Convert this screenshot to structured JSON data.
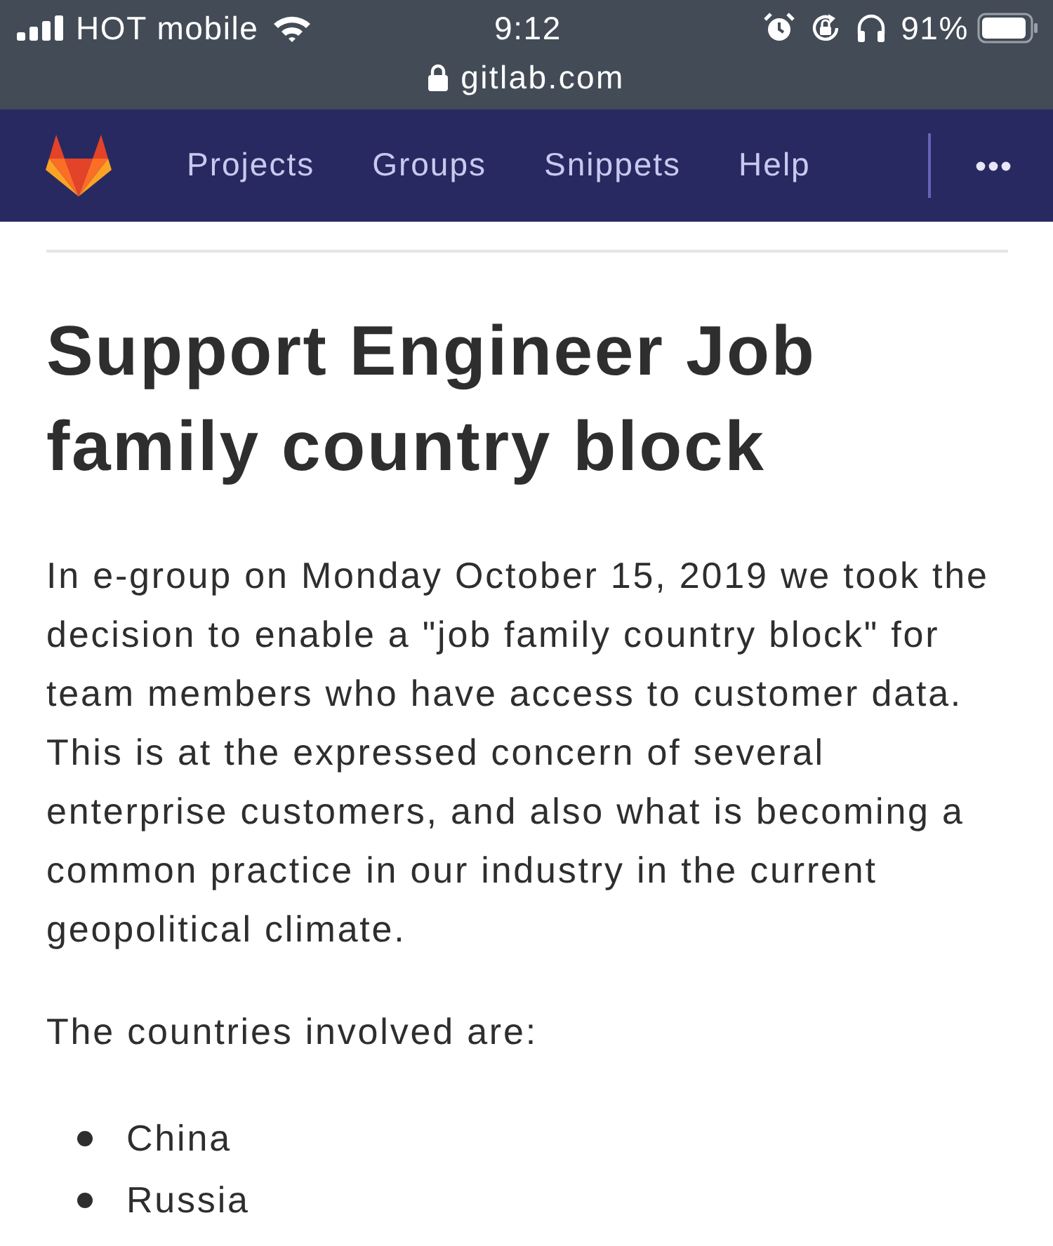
{
  "status_bar": {
    "carrier": "HOT mobile",
    "time": "9:12",
    "battery": "91%"
  },
  "address_bar": {
    "url": "gitlab.com"
  },
  "navbar": {
    "links": [
      {
        "label": "Projects"
      },
      {
        "label": "Groups"
      },
      {
        "label": "Snippets"
      },
      {
        "label": "Help"
      }
    ]
  },
  "article": {
    "title": "Support Engineer Job family country block",
    "paragraphs": [
      "In e-group on Monday October 15, 2019 we took the decision to enable a \"job family country block\" for team members who have access to customer data. This is at the expressed concern of several enterprise customers, and also what is becoming a common practice in our industry in the current geopolitical climate.",
      "The countries involved are:"
    ],
    "countries": [
      "China",
      "Russia"
    ]
  }
}
